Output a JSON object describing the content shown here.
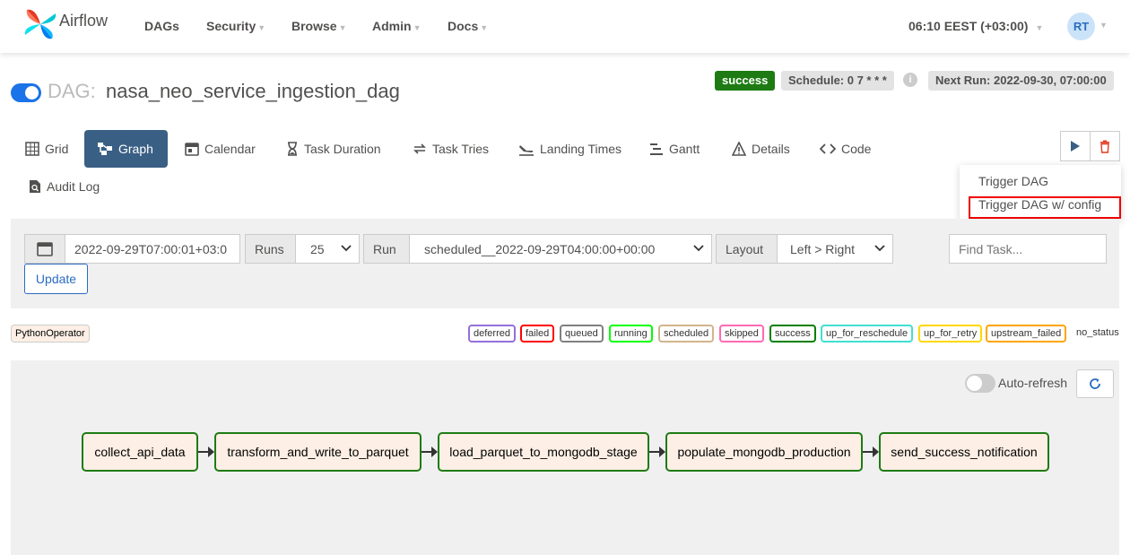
{
  "navbar": {
    "brand": "Airflow",
    "items": [
      {
        "label": "DAGs",
        "caret": false
      },
      {
        "label": "Security",
        "caret": true
      },
      {
        "label": "Browse",
        "caret": true
      },
      {
        "label": "Admin",
        "caret": true
      },
      {
        "label": "Docs",
        "caret": true
      }
    ],
    "clock": "06:10 EEST (+03:00)",
    "avatar": "RT"
  },
  "dag": {
    "prefix": "DAG:",
    "id": "nasa_neo_service_ingestion_dag",
    "paused": false,
    "status": "success",
    "schedule": "Schedule: 0 7 * * *",
    "next_run": "Next Run: 2022-09-30, 07:00:00"
  },
  "tabs": [
    {
      "label": "Grid",
      "icon": "grid-icon"
    },
    {
      "label": "Graph",
      "icon": "graph-icon",
      "active": true
    },
    {
      "label": "Calendar",
      "icon": "calendar-icon"
    },
    {
      "label": "Task Duration",
      "icon": "hourglass-icon"
    },
    {
      "label": "Task Tries",
      "icon": "retry-icon"
    },
    {
      "label": "Landing Times",
      "icon": "landing-icon"
    },
    {
      "label": "Gantt",
      "icon": "gantt-icon"
    },
    {
      "label": "Details",
      "icon": "warning-icon"
    },
    {
      "label": "Code",
      "icon": "code-icon"
    },
    {
      "label": "Audit Log",
      "icon": "file-search-icon"
    }
  ],
  "trigger_menu": {
    "items": [
      "Trigger DAG",
      "Trigger DAG w/ config"
    ]
  },
  "filters": {
    "base_date": "2022-09-29T07:00:01+03:0",
    "runs_label": "Runs",
    "runs_value": "25",
    "run_label": "Run",
    "run_value": "scheduled__2022-09-29T04:00:00+00:00",
    "layout_label": "Layout",
    "layout_value": "Left > Right",
    "find_task_placeholder": "Find Task...",
    "update_label": "Update"
  },
  "legend": {
    "operator": "PythonOperator",
    "states": [
      {
        "label": "deferred",
        "color": "#9370db"
      },
      {
        "label": "failed",
        "color": "#ff0000"
      },
      {
        "label": "queued",
        "color": "#808080"
      },
      {
        "label": "running",
        "color": "#00ff00"
      },
      {
        "label": "scheduled",
        "color": "#d2b48c"
      },
      {
        "label": "skipped",
        "color": "#ff69b4"
      },
      {
        "label": "success",
        "color": "#008000"
      },
      {
        "label": "up_for_reschedule",
        "color": "#40e0d0"
      },
      {
        "label": "up_for_retry",
        "color": "#ffd700"
      },
      {
        "label": "upstream_failed",
        "color": "#ffa500"
      }
    ],
    "no_status": "no_status"
  },
  "graph": {
    "auto_refresh_label": "Auto-refresh",
    "auto_refresh_on": false,
    "tasks": [
      "collect_api_data",
      "transform_and_write_to_parquet",
      "load_parquet_to_mongodb_stage",
      "populate_mongodb_production",
      "send_success_notification"
    ]
  }
}
